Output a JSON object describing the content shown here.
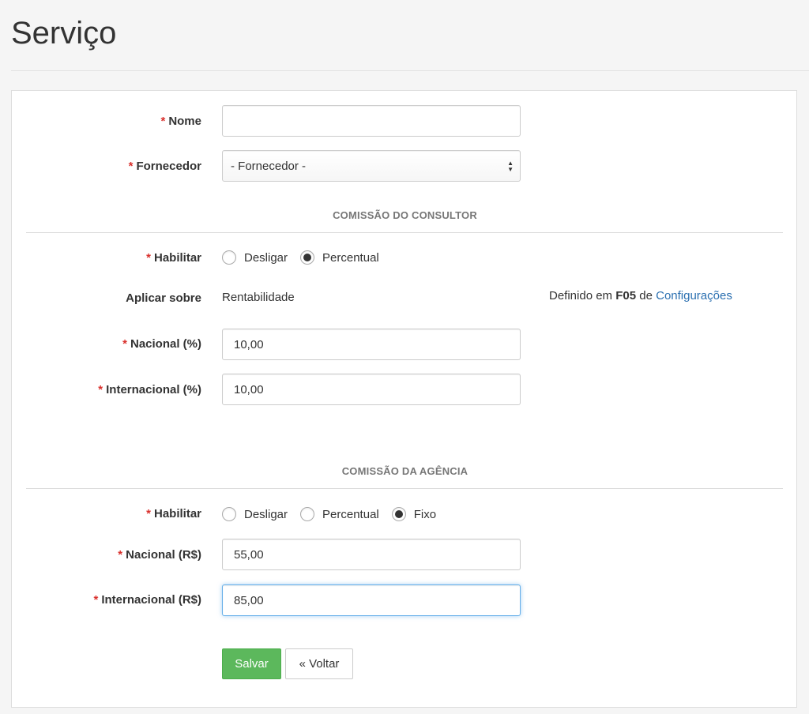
{
  "page": {
    "title": "Serviço"
  },
  "form": {
    "required_mark": "*",
    "nome": {
      "label": "Nome",
      "value": ""
    },
    "fornecedor": {
      "label": "Fornecedor",
      "selected": "- Fornecedor -"
    },
    "consultor": {
      "section_title": "COMISSÃO DO CONSULTOR",
      "habilitar_label": "Habilitar",
      "options": [
        {
          "label": "Desligar",
          "checked": false
        },
        {
          "label": "Percentual",
          "checked": true
        }
      ],
      "aplicar_label": "Aplicar sobre",
      "aplicar_value": "Rentabilidade",
      "defined_prefix": "Definido em",
      "defined_code": "F05",
      "defined_mid": "de",
      "defined_link": "Configurações",
      "nacional": {
        "label": "Nacional (%)",
        "value": "10,00"
      },
      "internacional": {
        "label": "Internacional (%)",
        "value": "10,00"
      }
    },
    "agencia": {
      "section_title": "COMISSÃO DA AGÊNCIA",
      "habilitar_label": "Habilitar",
      "options": [
        {
          "label": "Desligar",
          "checked": false
        },
        {
          "label": "Percentual",
          "checked": false
        },
        {
          "label": "Fixo",
          "checked": true
        }
      ],
      "nacional": {
        "label": "Nacional (R$)",
        "value": "55,00"
      },
      "internacional": {
        "label": "Internacional (R$)",
        "value": "85,00"
      }
    },
    "buttons": {
      "save": "Salvar",
      "back": "« Voltar"
    }
  }
}
